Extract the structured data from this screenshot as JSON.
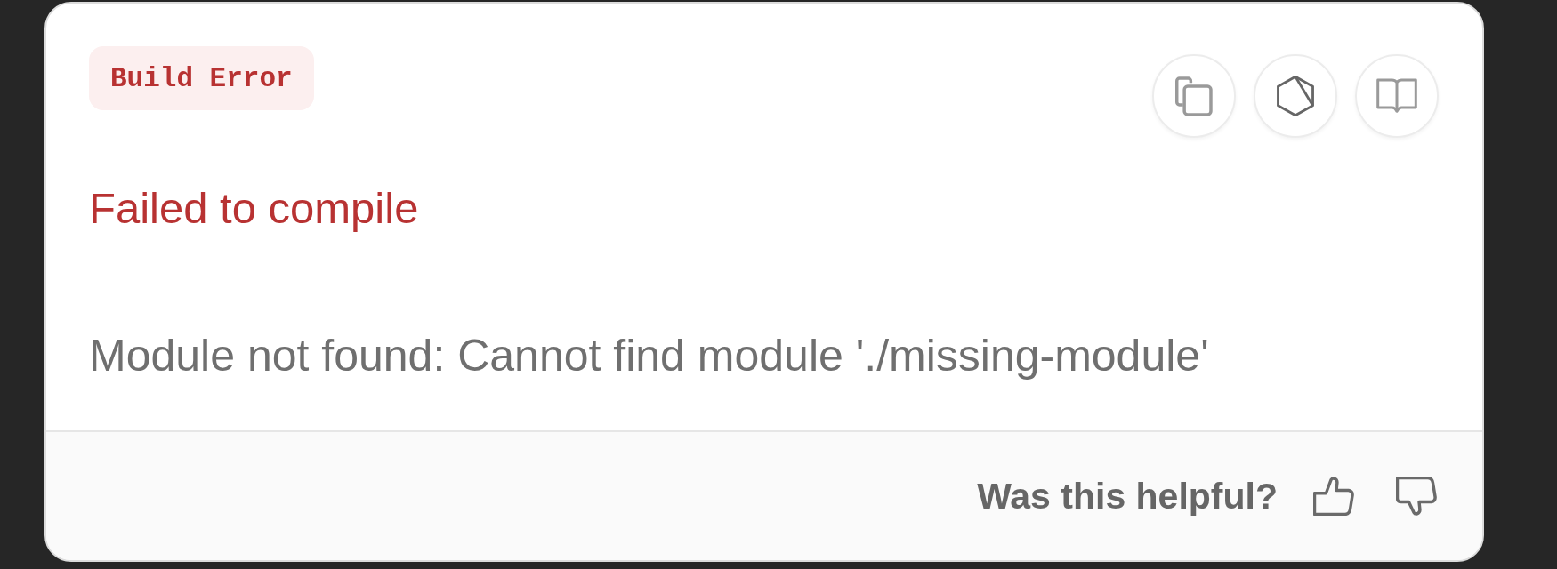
{
  "badge": {
    "label": "Build Error"
  },
  "actions": [
    {
      "kind": "copy"
    },
    {
      "kind": "hexagon"
    },
    {
      "kind": "docs"
    }
  ],
  "title": "Failed to compile",
  "message": "Module not found: Cannot find module './missing-module'",
  "feedback": {
    "question": "Was this helpful?",
    "buttons": [
      {
        "kind": "thumbs_up"
      },
      {
        "kind": "thumbs_down"
      }
    ]
  }
}
